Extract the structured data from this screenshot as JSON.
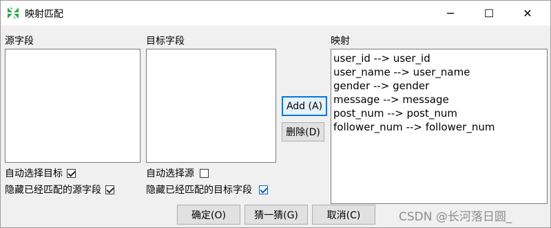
{
  "window": {
    "title": "映射匹配"
  },
  "titlebar_controls": {
    "minimize": "─",
    "maximize": "☐",
    "close": "✕"
  },
  "source": {
    "label": "源字段",
    "items": []
  },
  "target": {
    "label": "目标字段",
    "items": []
  },
  "mapping": {
    "label": "映射",
    "items": [
      "user_id --> user_id",
      "user_name --> user_name",
      "gender --> gender",
      "message --> message",
      "post_num --> post_num",
      "follower_num --> follower_num"
    ]
  },
  "options": {
    "auto_select_target": {
      "label": "自动选择目标",
      "checked": true
    },
    "hide_matched_source": {
      "label": "隐藏已经匹配的源字段",
      "checked": true
    },
    "auto_select_source": {
      "label": "自动选择源",
      "checked": false
    },
    "hide_matched_target": {
      "label": "隐藏已经匹配的目标字段",
      "checked": true
    }
  },
  "buttons": {
    "add": "Add (A)",
    "delete": "删除(D)",
    "ok": "确定(O)",
    "guess": "猜一猜(G)",
    "cancel": "取消(C)"
  },
  "watermark": "CSDN @长河落日圆_"
}
